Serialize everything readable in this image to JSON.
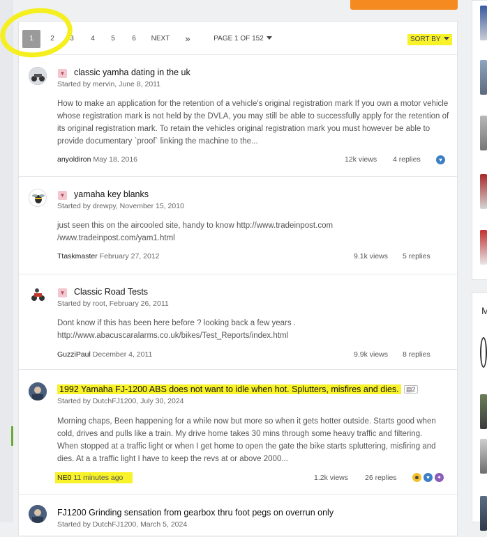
{
  "pagination": {
    "pages": [
      "1",
      "2",
      "3",
      "4",
      "5",
      "6"
    ],
    "next_label": "NEXT",
    "last_label": "»",
    "page_info": "PAGE 1 OF 152",
    "sort_label": "SORT BY"
  },
  "topics": [
    {
      "title": "classic yamha dating in the uk",
      "started": "Started by mervin, June 8, 2011",
      "snippet": "How to make an application for the retention of a vehicle's original registration mark If you own a motor vehicle whose registration mark is not held by the DVLA, you may still be able to successfully apply for the retention of its original registration mark. To retain the vehicles original registration mark you must however be able to provide documentary `proof` linking the machine to the...",
      "last_author": "anyoldiron",
      "last_date": "May 18, 2016",
      "views": "12k views",
      "replies": "4 replies",
      "pinned": true
    },
    {
      "title": "yamaha key blanks",
      "started": "Started by drewpy, November 15, 2010",
      "snippet": "just seen this on the aircooled site, handy to know http://www.tradeinpost.com /www.tradeinpost.com/yam1.html",
      "last_author": "Ttaskmaster",
      "last_date": "February 27, 2012",
      "views": "9.1k views",
      "replies": "5 replies",
      "pinned": true
    },
    {
      "title": "Classic Road Tests",
      "started": "Started by root, February 26, 2011",
      "snippet": "Dont know if this has been here before ? looking back a few years . http://www.abacuscaralarms.co.uk/bikes/Test_Reports/index.html",
      "last_author": "GuzziPaul",
      "last_date": "December 4, 2011",
      "views": "9.9k views",
      "replies": "8 replies",
      "pinned": true
    },
    {
      "title": "1992 Yamaha FJ-1200 ABS does not want to idle when hot. Splutters, misfires and dies.",
      "page_count": "2",
      "started": "Started by DutchFJ1200, July 30, 2024",
      "snippet": "Morning chaps, Been happening for a while now but more so when it gets hotter outside. Starts good when cold, drives and pulls like a train. My drive home takes 30 mins through some heavy traffic and filtering. When stopped at a traffic light or when I get home to open the gate the bike starts spluttering, misfiring and dies. At a a traffic light I have to keep the revs at or above 2000...",
      "last_author": "NE0",
      "last_date": "11 minutes ago",
      "views": "1.2k views",
      "replies": "26 replies",
      "pinned": false
    },
    {
      "title": "FJ1200 Grinding sensation from gearbox thru foot pegs on overrun only",
      "started": "Started by DutchFJ1200, March 5, 2024",
      "pinned": false
    }
  ],
  "sidebar": {
    "heading_letter": "M"
  },
  "colors": {
    "highlight": "#f8f22a",
    "accent_orange": "#f58a20",
    "pin": "#f4c6cf"
  }
}
